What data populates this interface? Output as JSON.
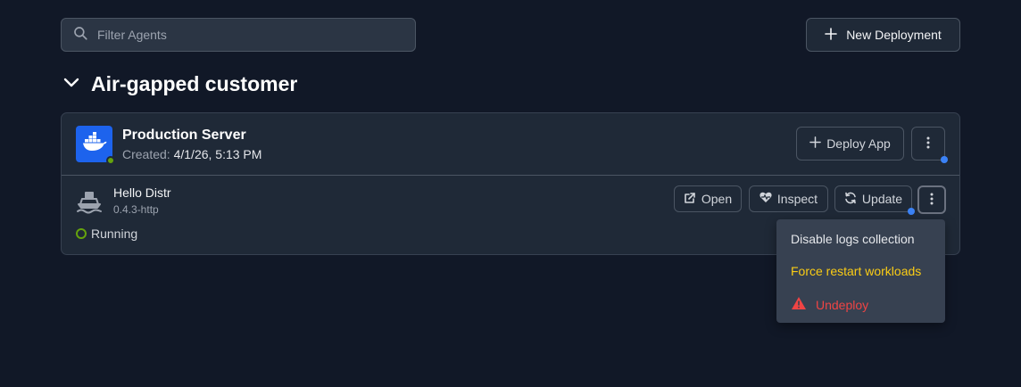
{
  "search": {
    "placeholder": "Filter Agents",
    "value": ""
  },
  "toolbar": {
    "new_deployment_label": "New Deployment"
  },
  "group": {
    "title": "Air-gapped customer",
    "server": {
      "name": "Production Server",
      "created_label": "Created:",
      "created_value": "4/1/26, 5:13 PM",
      "status_color": "#65a30d",
      "deploy_app_label": "Deploy App"
    },
    "app": {
      "name": "Hello Distr",
      "version": "0.4.3-http",
      "status": "Running",
      "status_color": "#65a30d",
      "actions": {
        "open": "Open",
        "inspect": "Inspect",
        "update": "Update"
      }
    }
  },
  "context_menu": {
    "items": [
      {
        "label": "Disable logs collection",
        "color": "#e5e7eb"
      },
      {
        "label": "Force restart workloads",
        "color": "#facc15"
      },
      {
        "label": "Undeploy",
        "color": "#ef4444",
        "icon": "warning-icon"
      }
    ]
  },
  "colors": {
    "accent": "#3b82f6",
    "background": "#111827",
    "card": "#1f2937"
  }
}
